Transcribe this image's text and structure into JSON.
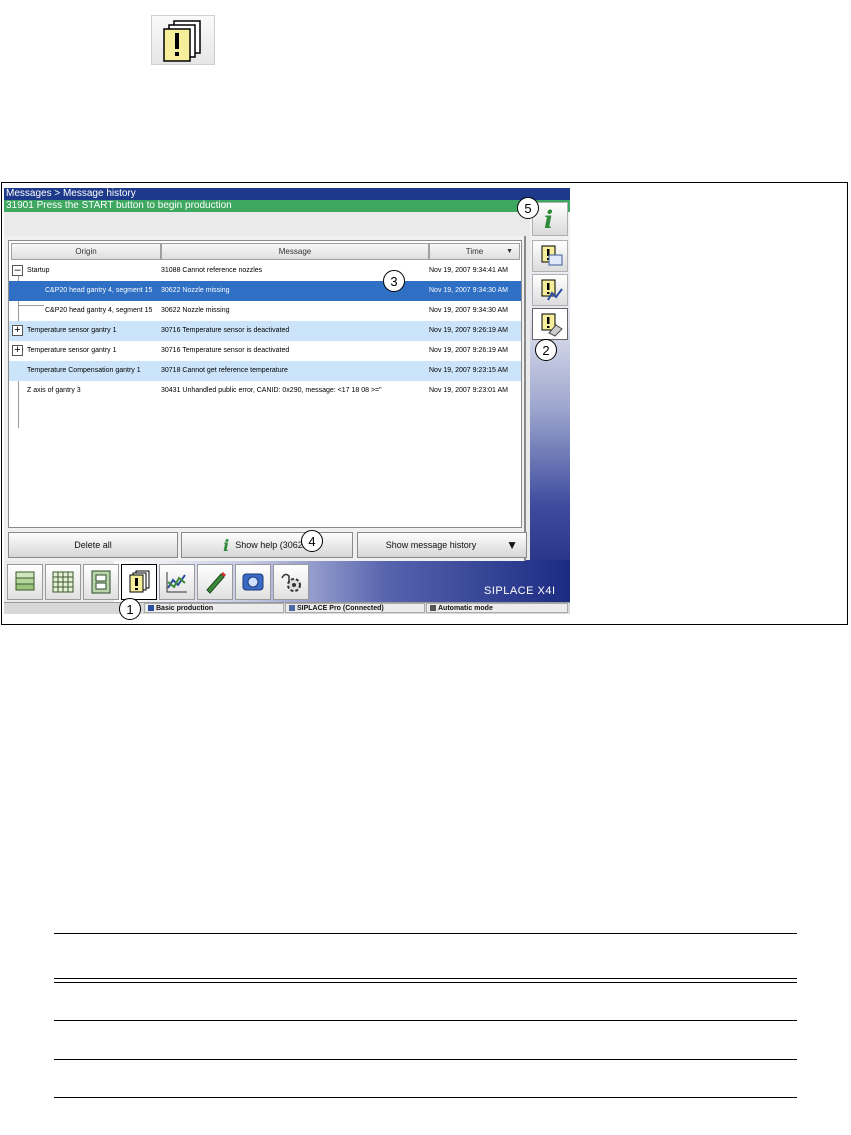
{
  "window": {
    "breadcrumb": "Messages > Message history",
    "status_message": "31901 Press the START button to begin production"
  },
  "table": {
    "columns": [
      "Origin",
      "Message",
      "Time"
    ],
    "rows": [
      {
        "origin": "Startup",
        "message": "31088 Cannot reference nozzles",
        "time": "Nov 19, 2007 9:34:41 AM",
        "state": "normal"
      },
      {
        "origin": "C&P20 head gantry 4, segment 15",
        "message": "30622 Nozzle missing",
        "time": "Nov 19, 2007 9:34:30 AM",
        "state": "selected"
      },
      {
        "origin": "C&P20 head gantry 4, segment 15",
        "message": "30622 Nozzle missing",
        "time": "Nov 19, 2007 9:34:30 AM",
        "state": "normal"
      },
      {
        "origin": "Temperature sensor gantry 1",
        "message": "30716 Temperature sensor is deactivated",
        "time": "Nov 19, 2007 9:26:19 AM",
        "state": "highlight"
      },
      {
        "origin": "Temperature sensor gantry 1",
        "message": "30716 Temperature sensor is deactivated",
        "time": "Nov 19, 2007 9:26:19 AM",
        "state": "normal"
      },
      {
        "origin": "Temperature Compensation gantry 1",
        "message": "30718 Cannot get reference temperature",
        "time": "Nov 19, 2007 9:23:15 AM",
        "state": "highlight"
      },
      {
        "origin": "Z axis of gantry 3",
        "message": "30431 Unhandled public error, CANID: 0x290, message: <17 18 08 >=\"",
        "time": "Nov 19, 2007 9:23:01 AM",
        "state": "normal"
      }
    ]
  },
  "buttons": {
    "delete_all": "Delete all",
    "show_help": "Show help (30622)",
    "show_history": "Show message history"
  },
  "brand": "SIPLACE X4I",
  "footer": {
    "mode": "Basic production",
    "connection": "SIPLACE Pro (Connected)",
    "operation": "Automatic mode"
  },
  "callouts": [
    "1",
    "2",
    "3",
    "4",
    "5"
  ],
  "colors": {
    "title_bar": "#1d3a8a",
    "status_bar": "#3ea861",
    "selected_row": "#2f6fc4",
    "highlight_row": "#cce4fa"
  }
}
